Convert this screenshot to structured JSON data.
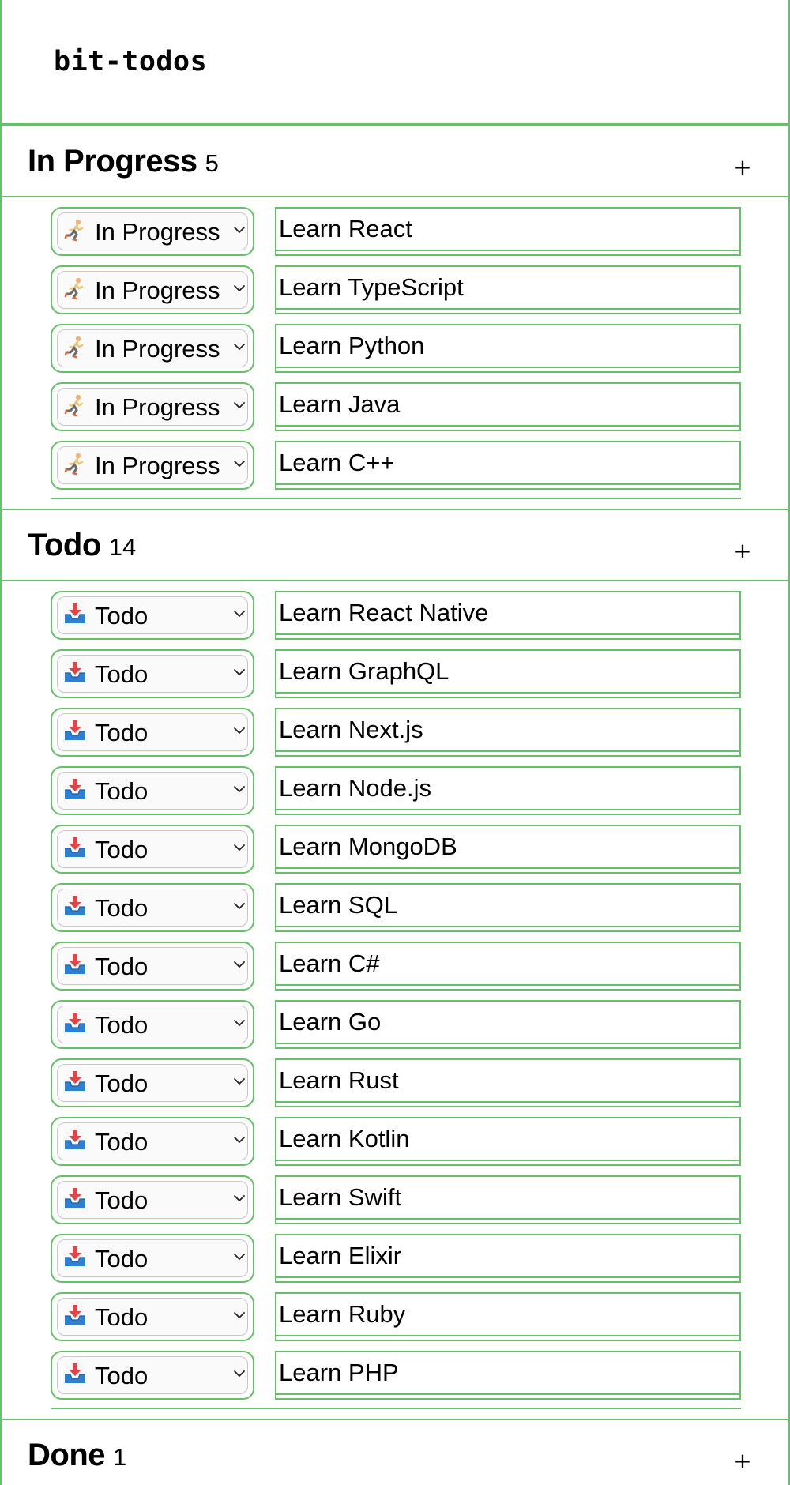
{
  "app": {
    "title": "bit-todos",
    "accent_color": "#64c167"
  },
  "sections": [
    {
      "title": "In Progress",
      "count": "5",
      "add_label": "+",
      "status_icon": "runner-icon",
      "items": [
        {
          "status": "In Progress",
          "text": "Learn React"
        },
        {
          "status": "In Progress",
          "text": "Learn TypeScript"
        },
        {
          "status": "In Progress",
          "text": "Learn Python"
        },
        {
          "status": "In Progress",
          "text": "Learn Java"
        },
        {
          "status": "In Progress",
          "text": "Learn C++"
        }
      ]
    },
    {
      "title": "Todo",
      "count": "14",
      "add_label": "+",
      "status_icon": "inbox-tray-icon",
      "items": [
        {
          "status": "Todo",
          "text": "Learn React Native"
        },
        {
          "status": "Todo",
          "text": "Learn GraphQL"
        },
        {
          "status": "Todo",
          "text": "Learn Next.js"
        },
        {
          "status": "Todo",
          "text": "Learn Node.js"
        },
        {
          "status": "Todo",
          "text": "Learn MongoDB"
        },
        {
          "status": "Todo",
          "text": "Learn SQL"
        },
        {
          "status": "Todo",
          "text": "Learn C#"
        },
        {
          "status": "Todo",
          "text": "Learn Go"
        },
        {
          "status": "Todo",
          "text": "Learn Rust"
        },
        {
          "status": "Todo",
          "text": "Learn Kotlin"
        },
        {
          "status": "Todo",
          "text": "Learn Swift"
        },
        {
          "status": "Todo",
          "text": "Learn Elixir"
        },
        {
          "status": "Todo",
          "text": "Learn Ruby"
        },
        {
          "status": "Todo",
          "text": "Learn PHP"
        }
      ]
    },
    {
      "title": "Done",
      "count": "1",
      "add_label": "+",
      "status_icon": "check-icon",
      "items": []
    }
  ]
}
